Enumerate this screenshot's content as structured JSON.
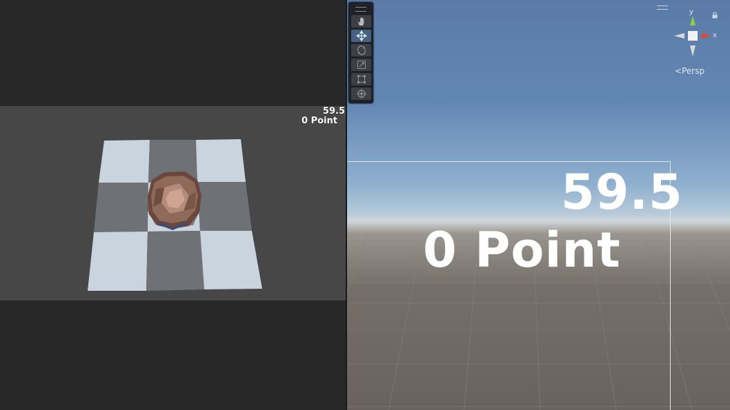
{
  "game_view": {
    "hud": {
      "timer": "59.5",
      "score": "0 Point"
    },
    "background_color": "#474747",
    "board_light_color": "#c9d4df",
    "board_dark_color": "#6f7377",
    "bowl_color": "#7a5446"
  },
  "scene_view": {
    "tools": [
      {
        "name": "hand-tool",
        "icon": "hand-icon",
        "active": false
      },
      {
        "name": "move-tool",
        "icon": "move-arrows-icon",
        "active": true
      },
      {
        "name": "rotate-tool",
        "icon": "rotate-icon",
        "active": false
      },
      {
        "name": "scale-tool",
        "icon": "scale-icon",
        "active": false
      },
      {
        "name": "rect-tool",
        "icon": "rect-transform-icon",
        "active": false
      },
      {
        "name": "transform-tool",
        "icon": "transform-icon",
        "active": false
      }
    ],
    "gizmo": {
      "y_label": "y",
      "x_label": "x",
      "projection_label": "Persp",
      "projection_glyph": "<"
    },
    "world_text": {
      "timer": "59.5",
      "score": "0 Point"
    },
    "sky_color": "#5a7ba7",
    "ground_color": "#6a625e"
  }
}
